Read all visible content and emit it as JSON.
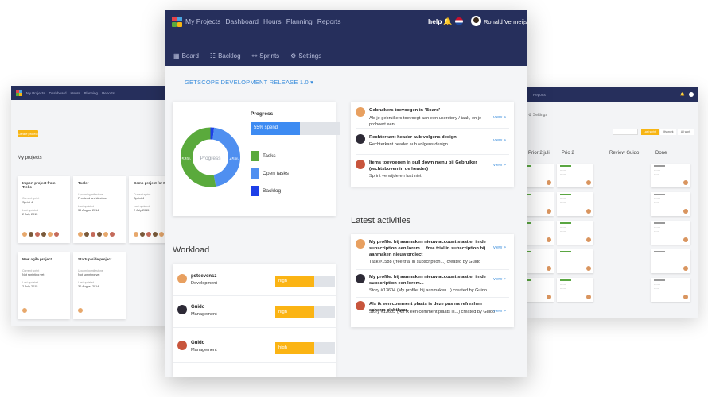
{
  "nav": {
    "links": [
      "My Projects",
      "Dashboard",
      "Hours",
      "Planning",
      "Reports"
    ],
    "help": "help",
    "user": "Ronald Vermeijs",
    "subnav": [
      {
        "icon": "board-icon",
        "glyph": "▦",
        "label": "Board"
      },
      {
        "icon": "backlog-icon",
        "glyph": "☷",
        "label": "Backlog"
      },
      {
        "icon": "sprints-icon",
        "glyph": "⚯",
        "label": "Sprints"
      },
      {
        "icon": "settings-icon",
        "glyph": "⚙",
        "label": "Settings"
      }
    ]
  },
  "release_title": "GETSCOPE DEVELOPMENT RELEASE 1.0 ▾",
  "progress": {
    "title": "Progress",
    "bar_label": "55% spend",
    "bar_value": 0.55,
    "donut_center": "Progress",
    "donut_left_label": "53%",
    "donut_right_label": "45%",
    "slices": [
      {
        "name": "Tasks",
        "value": 53,
        "color": "#5aaa3c"
      },
      {
        "name": "Open tasks",
        "value": 45,
        "color": "#4f8ff0"
      },
      {
        "name": "Backlog",
        "value": 2,
        "color": "#1d3fe8"
      }
    ]
  },
  "tasks": [
    {
      "title": "Gebruikers toevoegen in 'Board'",
      "desc": "Als je gebruikers toevoegt aan een userstory / taak, en je probeert een ...",
      "view": "view >",
      "avatar": "#e8a060"
    },
    {
      "title": "Rechterkant header aub volgens design",
      "desc": "Rechterkant header aub volgens design",
      "view": "view >",
      "avatar": "#2d2a36"
    },
    {
      "title": "Items toevoegen in pull down menu bij Gebruiker (rechtsboven in de header)",
      "desc": "Sprint verwijderen lukt niet",
      "view": "view >",
      "avatar": "#c8553c"
    }
  ],
  "latest_title": "Latest activities",
  "activities": [
    {
      "title": "My profile: bij aanmaken nieuw account staat er in de subscription een lorem.... free trial in subscription bij aanmaken nieuw project",
      "desc": "Task #1588 (free trial in subscription...) created by Guido",
      "view": "view >",
      "avatar": "#e8a060"
    },
    {
      "title": "My profile: bij aanmaken nieuw account staat er in de subscription een lorem...",
      "desc": "Story #13604 (My profile: bij aanmaken...) created by Guido",
      "view": "view >",
      "avatar": "#2d2a36"
    },
    {
      "title": "Als ik een comment plaats is deze pas na refreshen scherm zichtbaar.",
      "desc": "Story #13603 (Als ik een comment plaats is...) created by Guido",
      "view": "view >",
      "avatar": "#c8553c"
    }
  ],
  "workload_title": "Workload",
  "workload": [
    {
      "name": "psteevensz",
      "role": "Development",
      "level": "high",
      "value": 0.65,
      "avatar": "#e8a060"
    },
    {
      "name": "Guido",
      "role": "Management",
      "level": "high",
      "value": 0.65,
      "avatar": "#2d2a36"
    },
    {
      "name": "Guido",
      "role": "Management",
      "level": "high",
      "value": 0.65,
      "avatar": "#c8553c"
    }
  ],
  "left_window": {
    "nav": [
      "My Projects",
      "Dashboard",
      "Hours",
      "Planning",
      "Reports"
    ],
    "create_button": "Create project",
    "heading": "My projects",
    "cards": [
      {
        "title": "Import project from Trello",
        "label1": "Current sprint",
        "value1": "Sprint 4",
        "label2": "Last updated",
        "value2": "2 July 2015"
      },
      {
        "title": "Tooler",
        "label1": "Upcoming milestone",
        "value1": "Frontend architecture",
        "label2": "Last updated",
        "value2": "30 August 2014"
      },
      {
        "title": "Demo project for M",
        "label1": "Current sprint",
        "value1": "Sprint 4",
        "label2": "Last updated",
        "value2": "2 July 2015"
      },
      {
        "title": "New agile project",
        "label1": "Current sprint",
        "value1": "Not sprinting yet",
        "label2": "Last updated",
        "value2": "2 July 2015"
      },
      {
        "title": "Startup side project",
        "label1": "Upcoming milestone",
        "value1": "Not sprinting yet",
        "label2": "Last updated",
        "value2": "30 August 2014"
      }
    ]
  },
  "right_window": {
    "nav": "Reports",
    "tab": "Settings",
    "columns": [
      "Prior 2 juli",
      "Prio 2",
      "Review Guido",
      "Done"
    ],
    "filters": [
      "Last sprint",
      "My work",
      "All work"
    ]
  }
}
